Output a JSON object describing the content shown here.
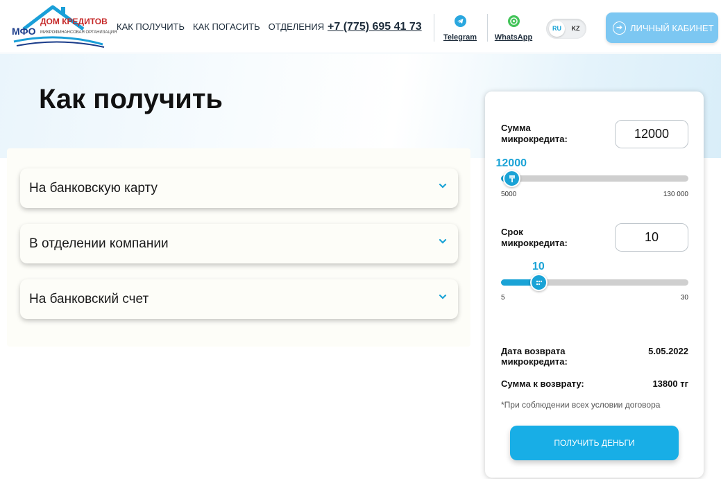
{
  "header": {
    "logo": {
      "mfo": "МФО",
      "name": "ДОМ КРЕДИТОВ",
      "subtitle": "МИКРОФИНАНСОВАЯ ОРГАНИЗАЦИЯ"
    },
    "nav": [
      {
        "label": "КАК ПОЛУЧИТЬ"
      },
      {
        "label": "КАК ПОГАСИТЬ"
      },
      {
        "label": "ОТДЕЛЕНИЯ"
      }
    ],
    "phone": "+7 (775) 695 41 73",
    "messengers": [
      {
        "label": "Telegram",
        "icon": "telegram-icon",
        "color": "#2aa7df"
      },
      {
        "label": "WhatsApp",
        "icon": "whatsapp-icon",
        "color": "#44c45a"
      }
    ],
    "languages": {
      "active": "RU",
      "other": "KZ"
    },
    "cabinet_button": {
      "label": "ЛИЧНЫЙ КАБИНЕТ",
      "icon": "arrow-right-circle-icon"
    }
  },
  "main": {
    "title": "Как получить",
    "accordion": [
      {
        "label": "На банковскую карту",
        "icon": "chevron-down-icon"
      },
      {
        "label": "В отделении компании",
        "icon": "chevron-down-icon"
      },
      {
        "label": "На банковский счет",
        "icon": "chevron-down-icon"
      }
    ]
  },
  "calculator": {
    "amount": {
      "label": "Сумма микрокредита:",
      "value": "12000",
      "slider_value": "12000",
      "min": 5000,
      "max": 130000,
      "min_label": "5000",
      "max_label": "130 000",
      "thumb_icon": "tenge-icon"
    },
    "term": {
      "label": "Срок микрокредита:",
      "value": "10",
      "slider_value": "10",
      "min": 5,
      "max": 30,
      "min_label": "5",
      "max_label": "30",
      "thumb_icon": "dots-icon"
    },
    "return_date": {
      "label": "Дата возврата микрокредита:",
      "value": "5.05.2022"
    },
    "return_sum": {
      "label": "Сумма к возврату:",
      "value": "13800 тг"
    },
    "note": "*При соблюдении всех условии договора",
    "submit": "ПОЛУЧИТЬ ДЕНЬГИ"
  },
  "colors": {
    "accent": "#1aa3d6",
    "cabinet_button": "#7cc7f2",
    "submit": "#18aee6"
  }
}
